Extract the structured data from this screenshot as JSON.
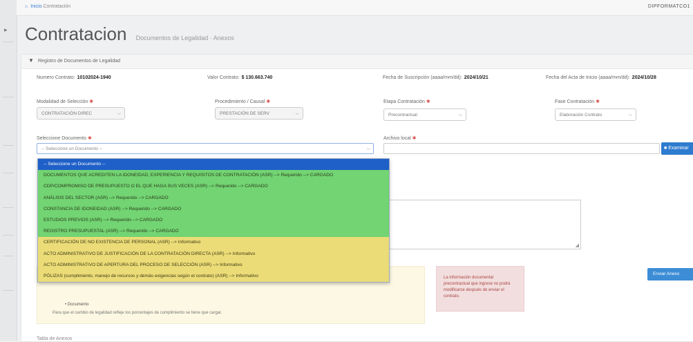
{
  "breadcrumb": {
    "home": "Inicio",
    "current": "Contratación"
  },
  "user": "DIPFORMATCO1",
  "page": {
    "title": "Contratacion",
    "subtitle": "Documentos de Legalidad · Anexos"
  },
  "panel": {
    "heading": "Registro de Documentos de Legalidad"
  },
  "info": {
    "contract_label": "Numero Contrato:",
    "contract_value": "10102024-1940",
    "value_label": "Valor Contrato:",
    "value_value": "$ 130.663.740",
    "sub_date_label": "Fecha de Suscripción (aaaa/mm/dd):",
    "sub_date_value": "2024/10/21",
    "end_date_label": "Fecha del Acta de Inicio (aaaa/mm/dd):",
    "end_date_value": "2024/10/28"
  },
  "form": {
    "modalidad_label": "Modalidad de Selección",
    "modalidad_value": "CONTRATACIÓN DIREC",
    "procedimiento_label": "Procedimiento / Causal",
    "procedimiento_value": "PRESTACIÓN DE SERV",
    "etapa_label": "Etapa Contratación",
    "etapa_value": "Precontractual",
    "fase_label": "Fase Contratación",
    "fase_value": "Elaboración Contrato",
    "documento_label": "Seleccione Documento",
    "documento_placeholder": "-- Seleccione un Documento --",
    "archivo_label": "Archivo local",
    "search_button": "Examinar",
    "send_button": "Enviar Anexo"
  },
  "dropdown": {
    "items": [
      {
        "label": "-- Seleccione un Documento --",
        "status": "selected"
      },
      {
        "label": "DOCUMENTOS QUE ACREDITEN LA IDONEIDAD, EXPERIENCIA Y REQUISITOS DE CONTRATACIÓN (ASR) --> Requerido --> CARGADO",
        "status": "cargado"
      },
      {
        "label": "CDP/COMPROMISO DE PRESUPUESTO O EL QUE HAGA SUS VECES (ASR) --> Requerido --> CARGADO",
        "status": "cargado"
      },
      {
        "label": "ANÁLISIS DEL SECTOR (ASR) --> Requerido --> CARGADO",
        "status": "cargado"
      },
      {
        "label": "CONSTANCIA DE IDONEIDAD (ASR) --> Requerido --> CARGADO",
        "status": "cargado"
      },
      {
        "label": "ESTUDIOS PREVIOS (ASR) --> Requerido --> CARGADO",
        "status": "cargado"
      },
      {
        "label": "REGISTRO PRESUPUESTAL (ASR) --> Requerido --> CARGADO",
        "status": "cargado"
      },
      {
        "label": "CERTIFICACIÓN DE NO EXISTENCIA DE PERSONAL (ASR) --> Informativo",
        "status": "informativo"
      },
      {
        "label": "ACTO ADMINISTRATIVO DE JUSTIFICACIÓN DE LA CONTRATACIÓN DIRECTA (ASR) --> Informativo",
        "status": "informativo"
      },
      {
        "label": "ACTO ADMINISTRATIVO DE APERTURA DEL PROCESO DE SELECCIÓN (ASR) --> Informativo",
        "status": "informativo"
      },
      {
        "label": "PÓLIZAS (cumplimiento, manejo de recursos y demás exigencias según el contrato) (ASR) --> Informativo",
        "status": "informativo"
      }
    ]
  },
  "hints": {
    "bullet": "• Documento",
    "note": "Para que el cambio de legalidad refleje los porcentajes de cumplimiento se tiene que cargar.",
    "danger": "La información documental precontractual que ingrese no podrá modificarse después de enviar el contrato."
  },
  "footer": "Tabla de Anexos"
}
